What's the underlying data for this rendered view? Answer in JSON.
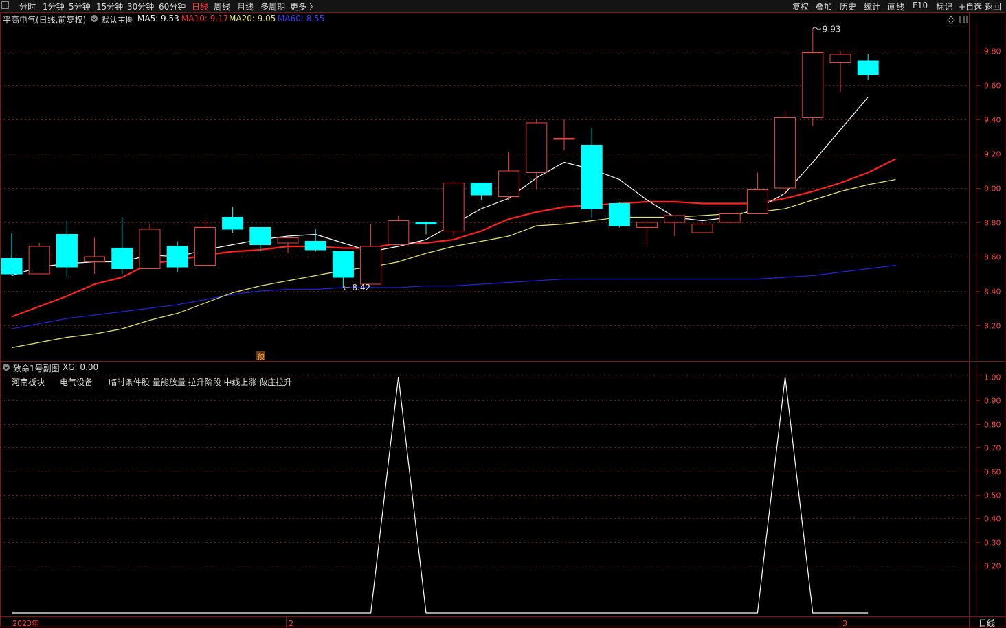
{
  "toolbar": {
    "periods": [
      "分时",
      "1分钟",
      "5分钟",
      "15分钟",
      "30分钟",
      "60分钟",
      "日线",
      "周线",
      "月线",
      "多周期",
      "更多 〉"
    ],
    "active_period": "日线",
    "right_buttons": [
      "复权",
      "叠加",
      "历史",
      "统计",
      "画线",
      "F10",
      "标记",
      "+自选",
      "返回"
    ]
  },
  "main_legend": {
    "stock": "平高电气(日线,前复权)",
    "template": "默认主图",
    "ma5": "MA5: 9.53",
    "ma10": "MA10: 9.17",
    "ma20": "MA20: 9.05",
    "ma60": "MA60: 8.55"
  },
  "sub_legend": {
    "title": "致命1号副图",
    "value": "XG: 0.00",
    "tags": [
      "河南板块",
      "电气设备",
      "临时条件股 量能放量 拉升阶段 中线上涨 做庄拉升"
    ]
  },
  "annotations": {
    "high": "9.93",
    "low": "8.42",
    "pre_marker": "预"
  },
  "x_axis": {
    "labels": [
      "2023年",
      "2",
      "3"
    ],
    "period_tag": "日线"
  },
  "colors": {
    "up": "#ff3b3b",
    "down": "#00ffff",
    "ma5": "#ffffff",
    "ma10": "#ff2020",
    "ma20": "#e8e860",
    "ma60": "#2020e0",
    "grid": "#7a1010"
  },
  "chart_data": [
    {
      "type": "candlestick",
      "title": "平高电气(日线,前复权)",
      "y_ticks": [
        8.2,
        8.4,
        8.6,
        8.8,
        9.0,
        9.2,
        9.4,
        9.6,
        9.8
      ],
      "ylim": [
        8.0,
        10.0
      ],
      "candles": [
        {
          "o": 8.59,
          "h": 8.74,
          "l": 8.49,
          "c": 8.5
        },
        {
          "o": 8.5,
          "h": 8.68,
          "l": 8.5,
          "c": 8.66
        },
        {
          "o": 8.73,
          "h": 8.81,
          "l": 8.48,
          "c": 8.54
        },
        {
          "o": 8.57,
          "h": 8.71,
          "l": 8.5,
          "c": 8.6
        },
        {
          "o": 8.65,
          "h": 8.83,
          "l": 8.5,
          "c": 8.53
        },
        {
          "o": 8.53,
          "h": 8.79,
          "l": 8.53,
          "c": 8.76
        },
        {
          "o": 8.66,
          "h": 8.69,
          "l": 8.51,
          "c": 8.54
        },
        {
          "o": 8.55,
          "h": 8.82,
          "l": 8.55,
          "c": 8.77
        },
        {
          "o": 8.83,
          "h": 8.89,
          "l": 8.74,
          "c": 8.76
        },
        {
          "o": 8.77,
          "h": 8.77,
          "l": 8.63,
          "c": 8.67
        },
        {
          "o": 8.68,
          "h": 8.72,
          "l": 8.62,
          "c": 8.71
        },
        {
          "o": 8.69,
          "h": 8.76,
          "l": 8.63,
          "c": 8.64
        },
        {
          "o": 8.63,
          "h": 8.63,
          "l": 8.42,
          "c": 8.48
        },
        {
          "o": 8.44,
          "h": 8.79,
          "l": 8.44,
          "c": 8.66
        },
        {
          "o": 8.67,
          "h": 8.84,
          "l": 8.67,
          "c": 8.81
        },
        {
          "o": 8.8,
          "h": 8.8,
          "l": 8.73,
          "c": 8.79
        },
        {
          "o": 8.75,
          "h": 9.04,
          "l": 8.72,
          "c": 9.03
        },
        {
          "o": 9.03,
          "h": 9.03,
          "l": 8.93,
          "c": 8.96
        },
        {
          "o": 8.95,
          "h": 9.21,
          "l": 8.93,
          "c": 9.1
        },
        {
          "o": 9.09,
          "h": 9.4,
          "l": 8.99,
          "c": 9.38
        },
        {
          "o": 9.29,
          "h": 9.4,
          "l": 9.22,
          "c": 9.29
        },
        {
          "o": 9.25,
          "h": 9.35,
          "l": 8.83,
          "c": 8.88
        },
        {
          "o": 8.91,
          "h": 8.92,
          "l": 8.77,
          "c": 8.78
        },
        {
          "o": 8.77,
          "h": 8.81,
          "l": 8.66,
          "c": 8.8
        },
        {
          "o": 8.8,
          "h": 8.84,
          "l": 8.72,
          "c": 8.84
        },
        {
          "o": 8.74,
          "h": 8.8,
          "l": 8.74,
          "c": 8.79
        },
        {
          "o": 8.8,
          "h": 8.85,
          "l": 8.8,
          "c": 8.85
        },
        {
          "o": 8.85,
          "h": 9.09,
          "l": 8.85,
          "c": 8.99
        },
        {
          "o": 9.0,
          "h": 9.45,
          "l": 8.96,
          "c": 9.41
        },
        {
          "o": 9.41,
          "h": 9.93,
          "l": 9.36,
          "c": 9.79
        },
        {
          "o": 9.73,
          "h": 9.8,
          "l": 9.56,
          "c": 9.78
        },
        {
          "o": 9.74,
          "h": 9.78,
          "l": 9.63,
          "c": 9.66
        }
      ],
      "series": [
        {
          "name": "MA5",
          "values": [
            8.49,
            8.54,
            8.56,
            8.57,
            8.57,
            8.61,
            8.6,
            8.64,
            8.67,
            8.7,
            8.72,
            8.73,
            8.68,
            8.63,
            8.66,
            8.7,
            8.79,
            8.88,
            8.94,
            9.06,
            9.15,
            9.11,
            9.05,
            8.93,
            8.83,
            8.81,
            8.83,
            8.88,
            8.97,
            9.15,
            9.34,
            9.53
          ]
        },
        {
          "name": "MA10",
          "values": [
            8.25,
            8.31,
            8.37,
            8.44,
            8.48,
            8.56,
            8.58,
            8.61,
            8.63,
            8.64,
            8.66,
            8.66,
            8.65,
            8.65,
            8.68,
            8.68,
            8.7,
            8.75,
            8.82,
            8.86,
            8.89,
            8.9,
            8.91,
            8.92,
            8.92,
            8.91,
            8.91,
            8.91,
            8.94,
            8.98,
            9.03,
            9.09,
            9.17
          ]
        },
        {
          "name": "MA20",
          "values": [
            8.07,
            8.1,
            8.13,
            8.15,
            8.18,
            8.23,
            8.27,
            8.33,
            8.39,
            8.43,
            8.46,
            8.49,
            8.52,
            8.54,
            8.57,
            8.62,
            8.66,
            8.69,
            8.72,
            8.78,
            8.79,
            8.81,
            8.83,
            8.83,
            8.83,
            8.84,
            8.85,
            8.86,
            8.88,
            8.93,
            8.98,
            9.02,
            9.05
          ]
        },
        {
          "name": "MA60",
          "values": [
            8.18,
            8.21,
            8.24,
            8.26,
            8.28,
            8.3,
            8.32,
            8.35,
            8.38,
            8.4,
            8.41,
            8.41,
            8.42,
            8.42,
            8.42,
            8.43,
            8.43,
            8.44,
            8.45,
            8.46,
            8.47,
            8.47,
            8.47,
            8.47,
            8.47,
            8.47,
            8.47,
            8.47,
            8.48,
            8.49,
            8.51,
            8.53,
            8.55
          ]
        }
      ]
    },
    {
      "type": "line",
      "title": "致命1号副图",
      "y_ticks": [
        0.2,
        0.3,
        0.4,
        0.5,
        0.6,
        0.7,
        0.8,
        0.9,
        1.0
      ],
      "ylim": [
        0.0,
        1.0
      ],
      "series": [
        {
          "name": "XG",
          "values": [
            0,
            0,
            0,
            0,
            0,
            0,
            0,
            0,
            0,
            0,
            0,
            0,
            0,
            0,
            1,
            0,
            0,
            0,
            0,
            0,
            0,
            0,
            0,
            0,
            0,
            0,
            0,
            0,
            1,
            0,
            0,
            0
          ]
        }
      ]
    }
  ]
}
